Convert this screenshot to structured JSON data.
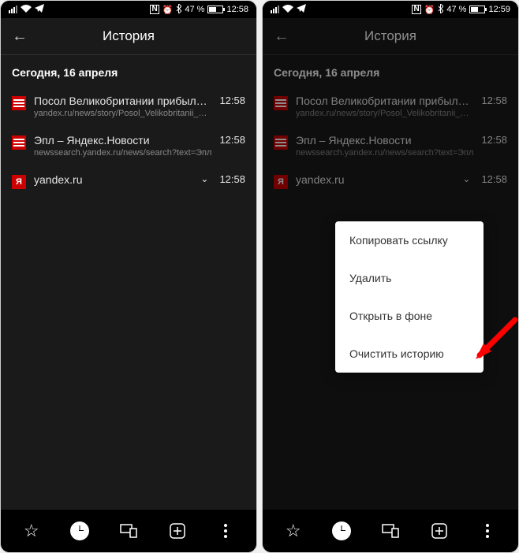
{
  "status": {
    "battery_text": "47 %",
    "left_time": "12:58",
    "right_time": "12:59"
  },
  "header": {
    "title": "История"
  },
  "section": {
    "date": "Сегодня, 16 апреля"
  },
  "items": [
    {
      "title": "Посол Великобритании прибыла в ро...",
      "subtitle": "yandex.ru/news/story/Posol_Velikobritanii_pri...",
      "time": "12:58"
    },
    {
      "title": "Эпл – Яндекс.Новости",
      "subtitle": "newssearch.yandex.ru/news/search?text=Эпл",
      "time": "12:58"
    },
    {
      "title": "yandex.ru",
      "subtitle": "",
      "time": "12:58"
    }
  ],
  "menu": {
    "copy": "Копировать ссылку",
    "delete": "Удалить",
    "background": "Открыть в фоне",
    "clear": "Очистить историю"
  },
  "yandex_letter": "Я"
}
